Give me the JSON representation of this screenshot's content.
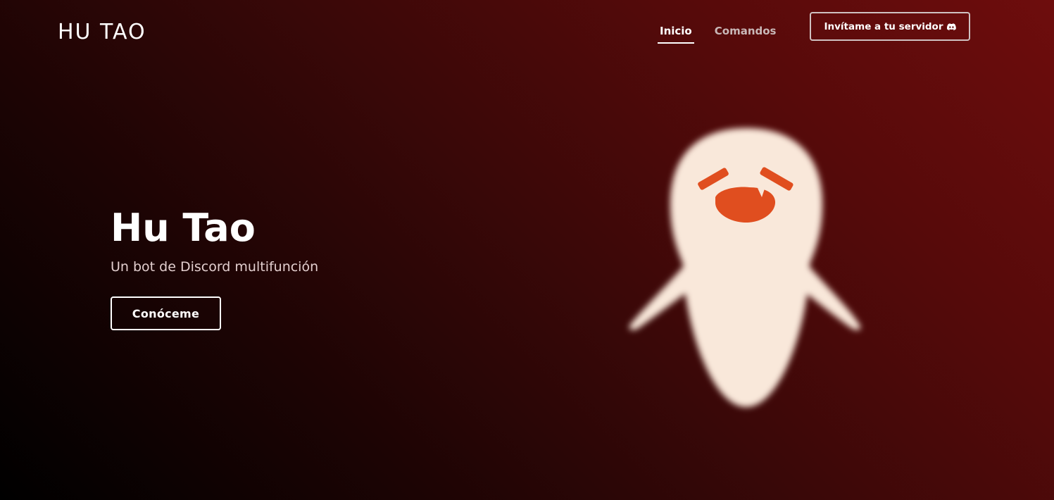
{
  "header": {
    "brand": "HU TAO",
    "nav": [
      {
        "label": "Inicio",
        "active": true
      },
      {
        "label": "Comandos",
        "active": false
      }
    ],
    "invite_label": "Invítame a tu servidor",
    "invite_icon": "discord-icon"
  },
  "hero": {
    "title": "Hu Tao",
    "subtitle": "Un bot de Discord multifunción",
    "cta_label": "Conóceme"
  },
  "illustration": {
    "name": "boo-tao-ghost",
    "body_color": "#f9e8da",
    "face_color": "#e04e1f"
  },
  "colors": {
    "background_dark": "#000000",
    "background_red": "#6e0d0d",
    "text": "#ffffff"
  }
}
